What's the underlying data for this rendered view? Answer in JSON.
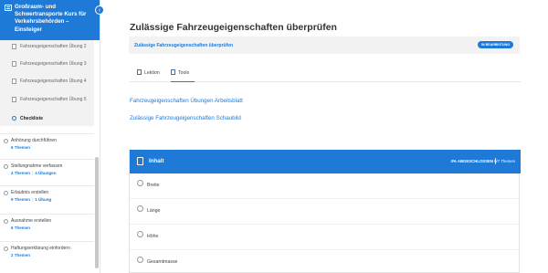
{
  "sidebar": {
    "course_title": "Großraum- und Schwertransporte Kurs für Verkehrsbehörden – Einsteiger",
    "collapse_icon": "chevron-left",
    "lessons": [
      {
        "label": "Fahrzeugeigenschaften Übung 2"
      },
      {
        "label": "Fahrzeugeigenschaften Übung 3"
      },
      {
        "label": "Fahrzeugeigenschaften Übung 4"
      },
      {
        "label": "Fahrzeugeigenschaften Übung 5"
      }
    ],
    "checklist_label": "Checkliste",
    "topics": [
      {
        "name": "Anhörung durchführen",
        "themen": "6 Themen",
        "uebungen": ""
      },
      {
        "name": "Stellungnahme verfassen",
        "themen": "4 Themen",
        "uebungen": "4 Übungen"
      },
      {
        "name": "Erlaubnis erstellen",
        "themen": "9 Themen",
        "uebungen": "1 Übung"
      },
      {
        "name": "Ausnahme erstellen",
        "themen": "6 Themen",
        "uebungen": ""
      },
      {
        "name": "Haftungserklärung einfordern",
        "themen": "2 Themen",
        "uebungen": ""
      }
    ]
  },
  "main": {
    "title": "Zulässige Fahrzeugeigenschaften überprüfen",
    "breadcrumb": "Zulässige Fahrzeugeigenschaften überprüfen",
    "status_badge": "IN BEARBEITUNG",
    "tabs": [
      {
        "label": "Lektion",
        "icon": "document-icon",
        "active": false
      },
      {
        "label": "Tools",
        "icon": "clipboard-icon",
        "active": true
      }
    ],
    "links": [
      "Fahrzeugeigenschaften Übungen Arbeitsblatt",
      "Zulässige Fahrzeugeigenschaften Schaubild"
    ],
    "content": {
      "title": "Inhalt",
      "progress": "0% ABGESCHLOSSEN",
      "count": "0/7 Themen",
      "topics": [
        "Breite",
        "Länge",
        "Höhe",
        "Gesamtmasse"
      ]
    }
  },
  "colors": {
    "accent": "#1e7ad6",
    "sidebar_bg": "#f2f2f2",
    "status_bar_bg": "#f2f2f2"
  }
}
